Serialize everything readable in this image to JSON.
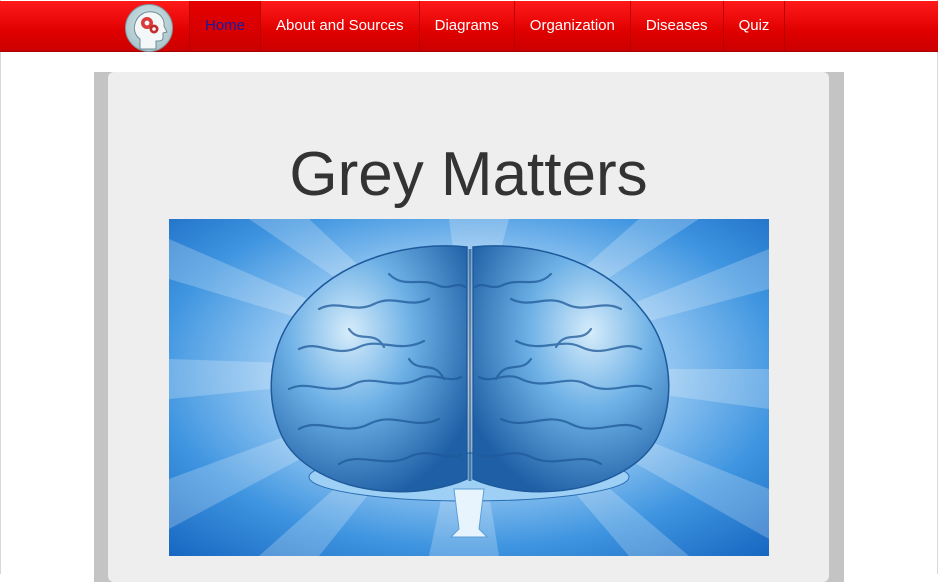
{
  "nav": {
    "items": [
      {
        "label": "Home",
        "active": true
      },
      {
        "label": "About and Sources",
        "active": false
      },
      {
        "label": "Diagrams",
        "active": false
      },
      {
        "label": "Organization",
        "active": false
      },
      {
        "label": "Diseases",
        "active": false
      },
      {
        "label": "Quiz",
        "active": false
      }
    ],
    "logo_icon": "head-with-gears-icon"
  },
  "main": {
    "title": "Grey Matters",
    "hero_image": "blue-brain-illustration"
  },
  "colors": {
    "nav_red": "#e00000",
    "active_text": "#1a1aa0",
    "card_bg": "#eeeeee",
    "frame_grey": "#c4c4c4",
    "title_text": "#333333",
    "brain_blue": "#3f8fd6"
  }
}
